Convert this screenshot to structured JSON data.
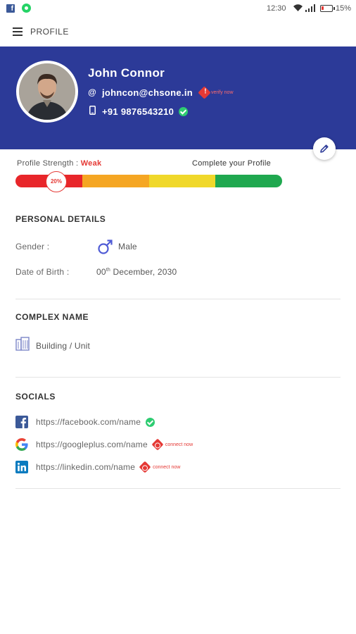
{
  "status_bar": {
    "time": "12:30",
    "battery": "15%"
  },
  "app_bar": {
    "title": "PROFILE"
  },
  "profile": {
    "name": "John Connor",
    "email_icon": "@",
    "email": "johncon@chsone.in",
    "verify_label": "verify now",
    "phone": "+91 9876543210"
  },
  "strength": {
    "label": "Profile Strength : ",
    "value": "Weak",
    "percent_label": "20%",
    "percent": 20,
    "complete_label": "Complete your Profile",
    "segment_colors": [
      "#e8262a",
      "#f5a623",
      "#f0d82a",
      "#1fa84f"
    ]
  },
  "personal": {
    "title": "PERSONAL DETAILS",
    "gender_label": "Gender :",
    "gender_value": "Male",
    "dob_label": "Date of Birth :",
    "dob_day": "00",
    "dob_suffix": "th",
    "dob_rest": " December, 2030"
  },
  "complex": {
    "title": "COMPLEX NAME",
    "value": "Building / Unit"
  },
  "socials": {
    "title": "SOCIALS",
    "items": [
      {
        "icon": "facebook-icon",
        "url": "https://facebook.com/name",
        "status": "verified"
      },
      {
        "icon": "google-icon",
        "url": "https://googleplus.com/name",
        "status": "connect now"
      },
      {
        "icon": "linkedin-icon",
        "url": "https://linkedin.com/name",
        "status": "connect now"
      }
    ]
  },
  "colors": {
    "header": "#2c3a98",
    "accent_red": "#e53935",
    "success": "#2ecc71"
  }
}
